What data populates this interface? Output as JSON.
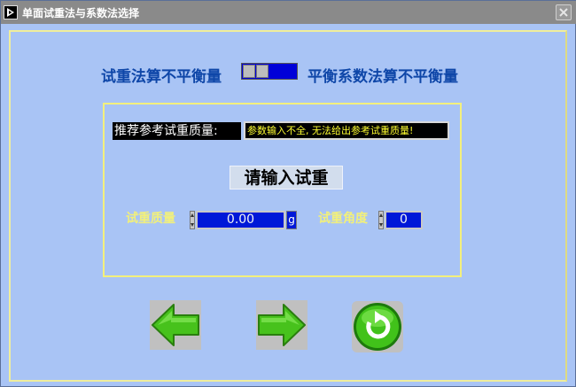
{
  "window": {
    "title": "单面试重法与系数法选择",
    "icons": {
      "app": "labview-run-icon",
      "close": "close-icon"
    }
  },
  "mode_selector": {
    "left_label": "试重法算不平衡量",
    "right_label": "平衡系数法算不平衡量",
    "selected": "right"
  },
  "recommendation": {
    "label": "推荐参考试重质量:",
    "value": "参数输入不全, 无法给出参考试重质量!"
  },
  "input_heading": "请输入试重",
  "trial_mass": {
    "label": "试重质量",
    "value": "0.00",
    "unit": "g"
  },
  "trial_angle": {
    "label": "试重角度",
    "value": "0"
  },
  "nav": {
    "back_icon": "arrow-left-icon",
    "next_icon": "arrow-right-icon",
    "reset_icon": "refresh-icon"
  },
  "colors": {
    "background": "#a9c4f5",
    "frame": "#f3f07c",
    "label_blue": "#0e46a8",
    "field_label_yellow": "#f2f07a",
    "field_blue": "#0018d8",
    "button_green": "#44c41c"
  }
}
